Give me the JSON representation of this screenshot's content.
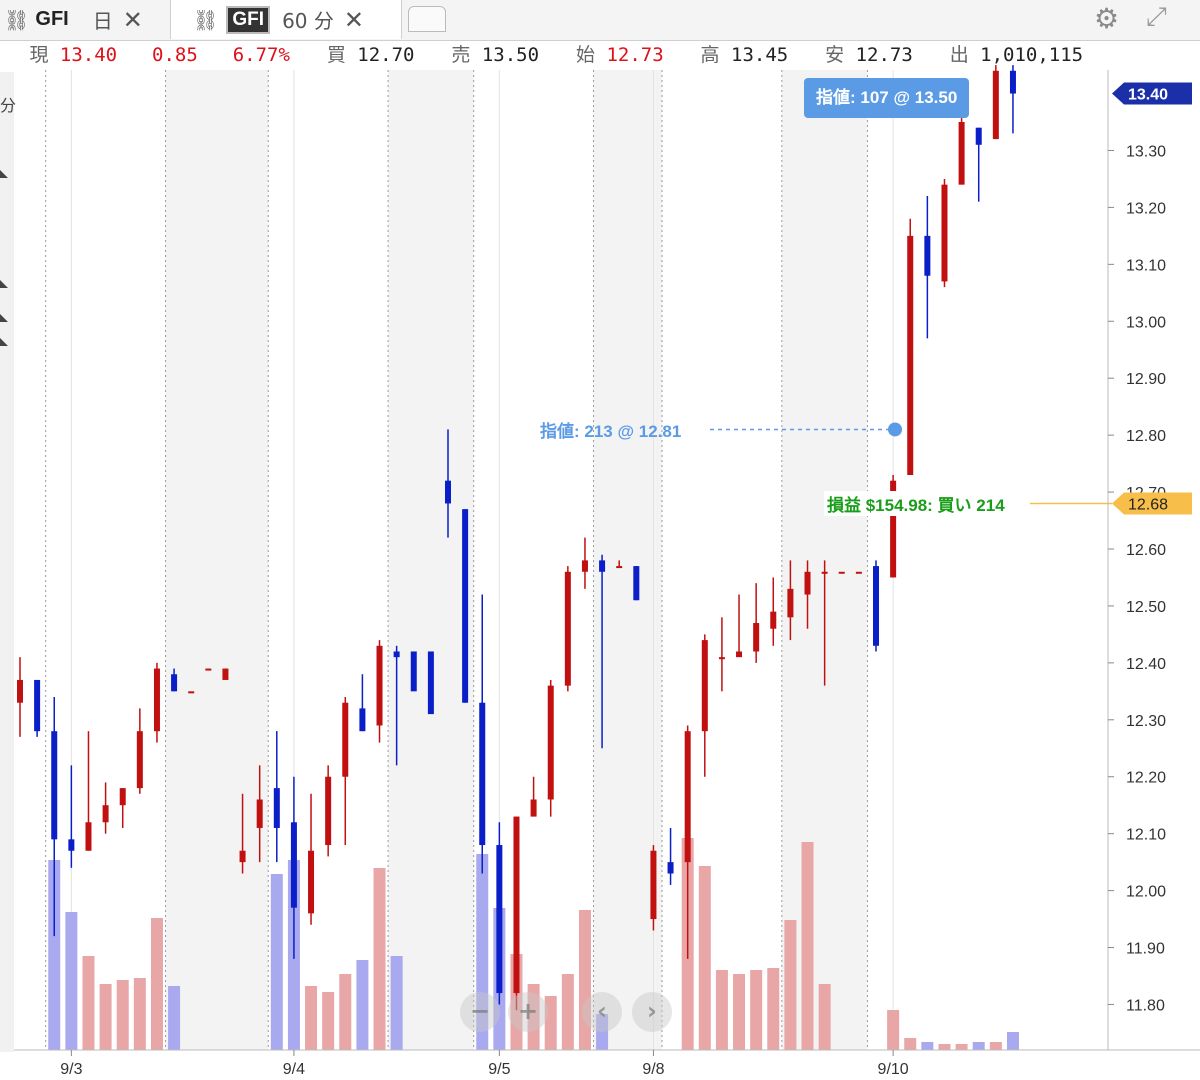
{
  "tabs": [
    {
      "symbol": "GFI",
      "period": "日",
      "close": "✕",
      "link_icon": "link-broken-icon"
    },
    {
      "symbol": "GFI",
      "period": "60 分",
      "close": "✕",
      "link_icon": "link-broken-icon"
    }
  ],
  "quote": {
    "current_label": "現",
    "current": "13.40",
    "change": "0.85",
    "change_pct": "6.77%",
    "bid_label": "買",
    "bid": "12.70",
    "ask_label": "売",
    "ask": "13.50",
    "open_label": "始",
    "open": "12.73",
    "high_label": "高",
    "high": "13.45",
    "low_label": "安",
    "low": "12.73",
    "volume_label": "出",
    "volume": "1,010,115"
  },
  "left_rail_text": "分",
  "colors": {
    "up": "#c01010",
    "down": "#0a1fc8",
    "vol_up": "#e9a6a6",
    "vol_down": "#a9a9f0",
    "current_tag": "#1a2fa8",
    "position_tag": "#f7bf4a",
    "order": "#5b9be6",
    "pnl": "#1a9e1a"
  },
  "chart_data": {
    "type": "candlestick",
    "ylim": [
      11.72,
      13.48
    ],
    "yticks": [
      "11.80",
      "11.90",
      "12.00",
      "12.10",
      "12.20",
      "12.30",
      "12.40",
      "12.50",
      "12.60",
      "12.70",
      "12.80",
      "12.90",
      "13.00",
      "13.10",
      "13.20",
      "13.30"
    ],
    "date_labels": [
      {
        "label": "9/3",
        "index": 3
      },
      {
        "label": "9/4",
        "index": 16
      },
      {
        "label": "9/5",
        "index": 28
      },
      {
        "label": "9/8",
        "index": 37
      },
      {
        "label": "9/10",
        "index": 51
      }
    ],
    "session_starts": [
      2,
      9,
      15,
      22,
      27,
      34,
      38,
      45,
      50
    ],
    "candles": [
      {
        "o": 12.33,
        "h": 12.41,
        "l": 12.27,
        "c": 12.37,
        "v": null
      },
      {
        "o": 12.37,
        "h": 12.37,
        "l": 12.27,
        "c": 12.28,
        "v": null
      },
      {
        "o": 12.28,
        "h": 12.34,
        "l": 11.92,
        "c": 12.09,
        "v": 0.95
      },
      {
        "o": 12.09,
        "h": 12.22,
        "l": 12.04,
        "c": 12.07,
        "v": 0.69
      },
      {
        "o": 12.07,
        "h": 12.28,
        "l": 12.07,
        "c": 12.12,
        "v": 0.47
      },
      {
        "o": 12.12,
        "h": 12.19,
        "l": 12.1,
        "c": 12.15,
        "v": 0.33
      },
      {
        "o": 12.15,
        "h": 12.18,
        "l": 12.11,
        "c": 12.18,
        "v": 0.35
      },
      {
        "o": 12.18,
        "h": 12.32,
        "l": 12.17,
        "c": 12.28,
        "v": 0.36
      },
      {
        "o": 12.28,
        "h": 12.4,
        "l": 12.26,
        "c": 12.39,
        "v": 0.66
      },
      {
        "o": 12.38,
        "h": 12.39,
        "l": 12.35,
        "c": 12.35,
        "v": 0.32
      },
      {
        "o": 12.35,
        "h": 12.35,
        "l": 12.35,
        "c": 12.35,
        "v": null
      },
      {
        "o": 12.39,
        "h": 12.39,
        "l": 12.39,
        "c": 12.39,
        "v": null
      },
      {
        "o": 12.37,
        "h": 12.39,
        "l": 12.37,
        "c": 12.39,
        "v": null
      },
      {
        "o": 12.05,
        "h": 12.17,
        "l": 12.03,
        "c": 12.07,
        "v": null
      },
      {
        "o": 12.11,
        "h": 12.22,
        "l": 12.05,
        "c": 12.16,
        "v": null
      },
      {
        "o": 12.18,
        "h": 12.28,
        "l": 12.05,
        "c": 12.11,
        "v": 0.88
      },
      {
        "o": 12.12,
        "h": 12.2,
        "l": 11.88,
        "c": 11.97,
        "v": 0.95
      },
      {
        "o": 11.96,
        "h": 12.17,
        "l": 11.94,
        "c": 12.07,
        "v": 0.32
      },
      {
        "o": 12.08,
        "h": 12.22,
        "l": 12.06,
        "c": 12.2,
        "v": 0.29
      },
      {
        "o": 12.2,
        "h": 12.34,
        "l": 12.08,
        "c": 12.33,
        "v": 0.38
      },
      {
        "o": 12.32,
        "h": 12.38,
        "l": 12.28,
        "c": 12.28,
        "v": 0.45
      },
      {
        "o": 12.29,
        "h": 12.44,
        "l": 12.26,
        "c": 12.43,
        "v": 0.91
      },
      {
        "o": 12.42,
        "h": 12.43,
        "l": 12.22,
        "c": 12.41,
        "v": 0.47
      },
      {
        "o": 12.42,
        "h": 12.42,
        "l": 12.4,
        "c": 12.35,
        "v": null
      },
      {
        "o": 12.42,
        "h": 12.42,
        "l": 12.4,
        "c": 12.31,
        "v": null
      },
      {
        "o": 12.72,
        "h": 12.81,
        "l": 12.62,
        "c": 12.68,
        "v": null
      },
      {
        "o": 12.67,
        "h": 12.67,
        "l": 12.33,
        "c": 12.33,
        "v": null
      },
      {
        "o": 12.33,
        "h": 12.52,
        "l": 12.03,
        "c": 12.08,
        "v": 0.98
      },
      {
        "o": 12.08,
        "h": 12.12,
        "l": 11.8,
        "c": 11.82,
        "v": 0.71
      },
      {
        "o": 11.82,
        "h": 12.13,
        "l": 11.79,
        "c": 12.13,
        "v": 0.48
      },
      {
        "o": 12.13,
        "h": 12.2,
        "l": 12.13,
        "c": 12.16,
        "v": 0.33
      },
      {
        "o": 12.16,
        "h": 12.37,
        "l": 12.13,
        "c": 12.36,
        "v": 0.27
      },
      {
        "o": 12.36,
        "h": 12.57,
        "l": 12.35,
        "c": 12.56,
        "v": 0.38
      },
      {
        "o": 12.56,
        "h": 12.62,
        "l": 12.53,
        "c": 12.58,
        "v": 0.7
      },
      {
        "o": 12.58,
        "h": 12.59,
        "l": 12.25,
        "c": 12.56,
        "v": 0.18
      },
      {
        "o": 12.57,
        "h": 12.58,
        "l": 12.57,
        "c": 12.57,
        "v": null
      },
      {
        "o": 12.57,
        "h": 12.57,
        "l": 12.51,
        "c": 12.51,
        "v": null
      },
      {
        "o": 11.95,
        "h": 12.08,
        "l": 11.93,
        "c": 12.07,
        "v": null
      },
      {
        "o": 12.05,
        "h": 12.11,
        "l": 12.01,
        "c": 12.03,
        "v": null
      },
      {
        "o": 12.05,
        "h": 12.29,
        "l": 11.88,
        "c": 12.28,
        "v": 1.06
      },
      {
        "o": 12.28,
        "h": 12.45,
        "l": 12.2,
        "c": 12.44,
        "v": 0.92
      },
      {
        "o": 12.41,
        "h": 12.48,
        "l": 12.35,
        "c": 12.41,
        "v": 0.4
      },
      {
        "o": 12.41,
        "h": 12.52,
        "l": 12.42,
        "c": 12.42,
        "v": 0.38
      },
      {
        "o": 12.42,
        "h": 12.54,
        "l": 12.4,
        "c": 12.47,
        "v": 0.4
      },
      {
        "o": 12.46,
        "h": 12.55,
        "l": 12.43,
        "c": 12.49,
        "v": 0.41
      },
      {
        "o": 12.48,
        "h": 12.58,
        "l": 12.44,
        "c": 12.53,
        "v": 0.65
      },
      {
        "o": 12.52,
        "h": 12.58,
        "l": 12.46,
        "c": 12.56,
        "v": 1.04
      },
      {
        "o": 12.56,
        "h": 12.58,
        "l": 12.36,
        "c": 12.56,
        "v": 0.33
      },
      {
        "o": 12.56,
        "h": 12.56,
        "l": 12.56,
        "c": 12.56,
        "v": null
      },
      {
        "o": 12.56,
        "h": 12.56,
        "l": 12.56,
        "c": 12.56,
        "v": null
      },
      {
        "o": 12.57,
        "h": 12.58,
        "l": 12.42,
        "c": 12.43,
        "v": null
      },
      {
        "o": 12.55,
        "h": 12.73,
        "l": 12.55,
        "c": 12.72,
        "v": 0.2
      },
      {
        "o": 12.73,
        "h": 13.18,
        "l": 12.73,
        "c": 13.15,
        "v": 0.06
      },
      {
        "o": 13.15,
        "h": 13.22,
        "l": 12.97,
        "c": 13.08,
        "v": 0.04
      },
      {
        "o": 13.07,
        "h": 13.25,
        "l": 13.06,
        "c": 13.24,
        "v": 0.03
      },
      {
        "o": 13.24,
        "h": 13.36,
        "l": 13.24,
        "c": 13.35,
        "v": 0.03
      },
      {
        "o": 13.34,
        "h": 13.34,
        "l": 13.21,
        "c": 13.31,
        "v": 0.04
      },
      {
        "o": 13.32,
        "h": 13.45,
        "l": 13.32,
        "c": 13.44,
        "v": 0.04
      },
      {
        "o": 13.44,
        "h": 13.45,
        "l": 13.33,
        "c": 13.4,
        "v": 0.09
      }
    ],
    "current_price_label": "13.40",
    "current_price": 13.4,
    "position_price_label": "12.68",
    "position_price": 12.68,
    "orders": [
      {
        "text": "指値: 107 @ 13.50",
        "price": 13.5
      },
      {
        "text": "指値: 213 @ 12.81",
        "price": 12.81
      }
    ],
    "pnl_text": "損益 $154.98: 買い 214"
  },
  "nav_buttons": [
    "−",
    "+",
    "‹",
    "›"
  ]
}
